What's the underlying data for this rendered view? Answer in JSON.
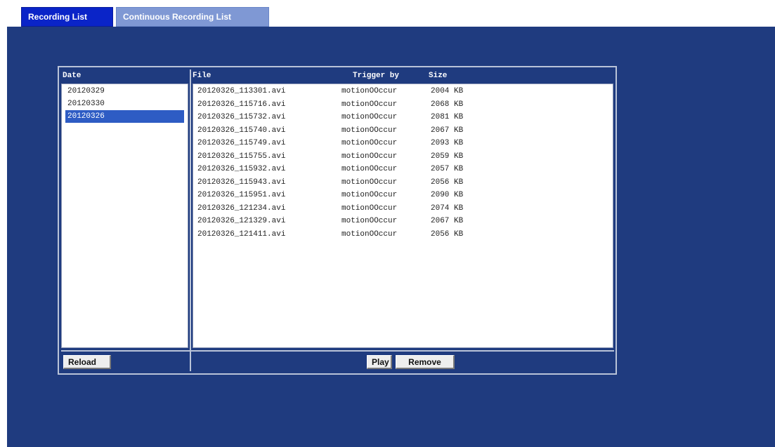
{
  "tabs": [
    {
      "label": "Recording List",
      "active": true
    },
    {
      "label": "Continuous Recording List",
      "active": false
    }
  ],
  "date_panel": {
    "header": "Date",
    "items": [
      "20120329",
      "20120330",
      "20120326"
    ],
    "selected": "20120326",
    "reload_label": "Reload"
  },
  "file_panel": {
    "headers": {
      "file": "File",
      "trigger": "Trigger by",
      "size": "Size"
    },
    "rows": [
      {
        "file": "20120326_113301.avi",
        "trigger": "motionOOccur",
        "size": "2004 KB"
      },
      {
        "file": "20120326_115716.avi",
        "trigger": "motionOOccur",
        "size": "2068 KB"
      },
      {
        "file": "20120326_115732.avi",
        "trigger": "motionOOccur",
        "size": "2081 KB"
      },
      {
        "file": "20120326_115740.avi",
        "trigger": "motionOOccur",
        "size": "2067 KB"
      },
      {
        "file": "20120326_115749.avi",
        "trigger": "motionOOccur",
        "size": "2093 KB"
      },
      {
        "file": "20120326_115755.avi",
        "trigger": "motionOOccur",
        "size": "2059 KB"
      },
      {
        "file": "20120326_115932.avi",
        "trigger": "motionOOccur",
        "size": "2057 KB"
      },
      {
        "file": "20120326_115943.avi",
        "trigger": "motionOOccur",
        "size": "2056 KB"
      },
      {
        "file": "20120326_115951.avi",
        "trigger": "motionOOccur",
        "size": "2090 KB"
      },
      {
        "file": "20120326_121234.avi",
        "trigger": "motionOOccur",
        "size": "2074 KB"
      },
      {
        "file": "20120326_121329.avi",
        "trigger": "motionOOccur",
        "size": "2067 KB"
      },
      {
        "file": "20120326_121411.avi",
        "trigger": "motionOOccur",
        "size": "2056 KB"
      }
    ],
    "play_label": "Play",
    "remove_label": "Remove"
  },
  "colors": {
    "panel_bg": "#1f3b7f",
    "tab_active": "#0a24c8",
    "tab_inactive": "#7f98d4",
    "selection": "#2e5cc4"
  }
}
